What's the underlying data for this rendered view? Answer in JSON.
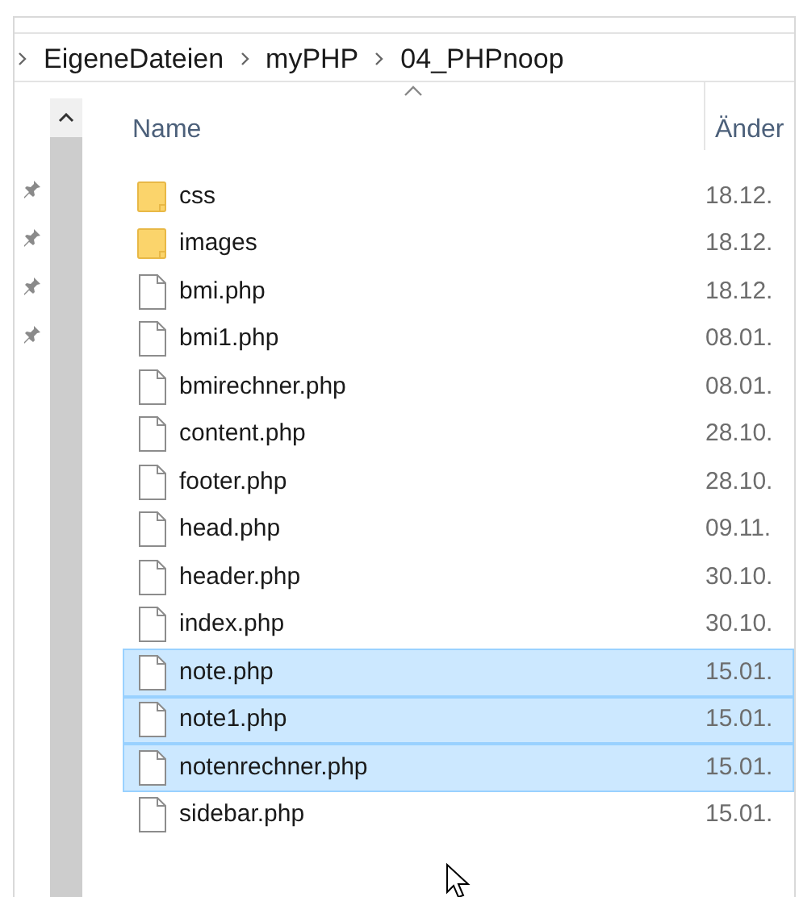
{
  "breadcrumb": [
    "EigeneDateien",
    "myPHP",
    "04_PHPnoop"
  ],
  "columns": [
    {
      "label": "Name",
      "sorted": true
    },
    {
      "label": "Änder",
      "sorted": false
    }
  ],
  "pins": [
    {
      "pinned": true
    },
    {
      "pinned": true
    },
    {
      "pinned": true
    },
    {
      "pinned": true
    }
  ],
  "files": [
    {
      "name": "css",
      "kind": "folder",
      "modified": "18.12.",
      "selected": false
    },
    {
      "name": "images",
      "kind": "folder",
      "modified": "18.12.",
      "selected": false
    },
    {
      "name": "bmi.php",
      "kind": "file",
      "modified": "18.12.",
      "selected": false
    },
    {
      "name": "bmi1.php",
      "kind": "file",
      "modified": "08.01.",
      "selected": false
    },
    {
      "name": "bmirechner.php",
      "kind": "file",
      "modified": "08.01.",
      "selected": false
    },
    {
      "name": "content.php",
      "kind": "file",
      "modified": "28.10.",
      "selected": false
    },
    {
      "name": "footer.php",
      "kind": "file",
      "modified": "28.10.",
      "selected": false
    },
    {
      "name": "head.php",
      "kind": "file",
      "modified": "09.11.",
      "selected": false
    },
    {
      "name": "header.php",
      "kind": "file",
      "modified": "30.10.",
      "selected": false
    },
    {
      "name": "index.php",
      "kind": "file",
      "modified": "30.10.",
      "selected": false
    },
    {
      "name": "note.php",
      "kind": "file",
      "modified": "15.01.",
      "selected": true
    },
    {
      "name": "note1.php",
      "kind": "file",
      "modified": "15.01.",
      "selected": true
    },
    {
      "name": "notenrechner.php",
      "kind": "file",
      "modified": "15.01.",
      "selected": true
    },
    {
      "name": "sidebar.php",
      "kind": "file",
      "modified": "15.01.",
      "selected": false
    }
  ]
}
